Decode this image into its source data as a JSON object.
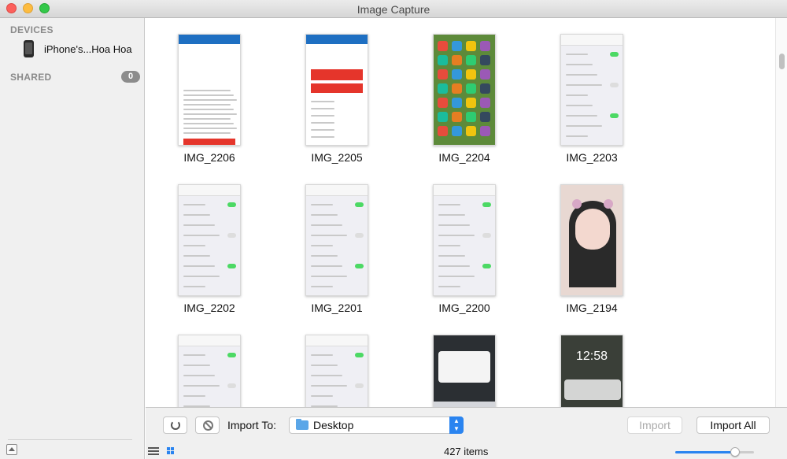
{
  "window": {
    "title": "Image Capture"
  },
  "sidebar": {
    "devices_header": "DEVICES",
    "device": {
      "name": "iPhone's...Hoa Hoa",
      "icon": "iphone-icon"
    },
    "shared_header": "SHARED",
    "shared_count": "0"
  },
  "grid": {
    "items": [
      {
        "name": "IMG_2206",
        "style": "t-white"
      },
      {
        "name": "IMG_2205",
        "style": "t-white"
      },
      {
        "name": "IMG_2204",
        "style": "t-green"
      },
      {
        "name": "IMG_2203",
        "style": "t-gray"
      },
      {
        "name": "IMG_2202",
        "style": "t-gray"
      },
      {
        "name": "IMG_2201",
        "style": "t-gray"
      },
      {
        "name": "IMG_2200",
        "style": "t-gray"
      },
      {
        "name": "IMG_2194",
        "style": "t-photo"
      },
      {
        "name": "",
        "style": "t-gray"
      },
      {
        "name": "",
        "style": "t-gray"
      },
      {
        "name": "",
        "style": "t-dark"
      },
      {
        "name": "",
        "style": "t-lock"
      }
    ]
  },
  "footer": {
    "import_to_label": "Import To:",
    "destination": "Desktop",
    "import_label": "Import",
    "import_all_label": "Import All",
    "items_count": "427 items",
    "zoom_level": 0.76
  },
  "colors": {
    "accent": "#2a84f0",
    "sidebar_bg": "#f0f0f0"
  }
}
